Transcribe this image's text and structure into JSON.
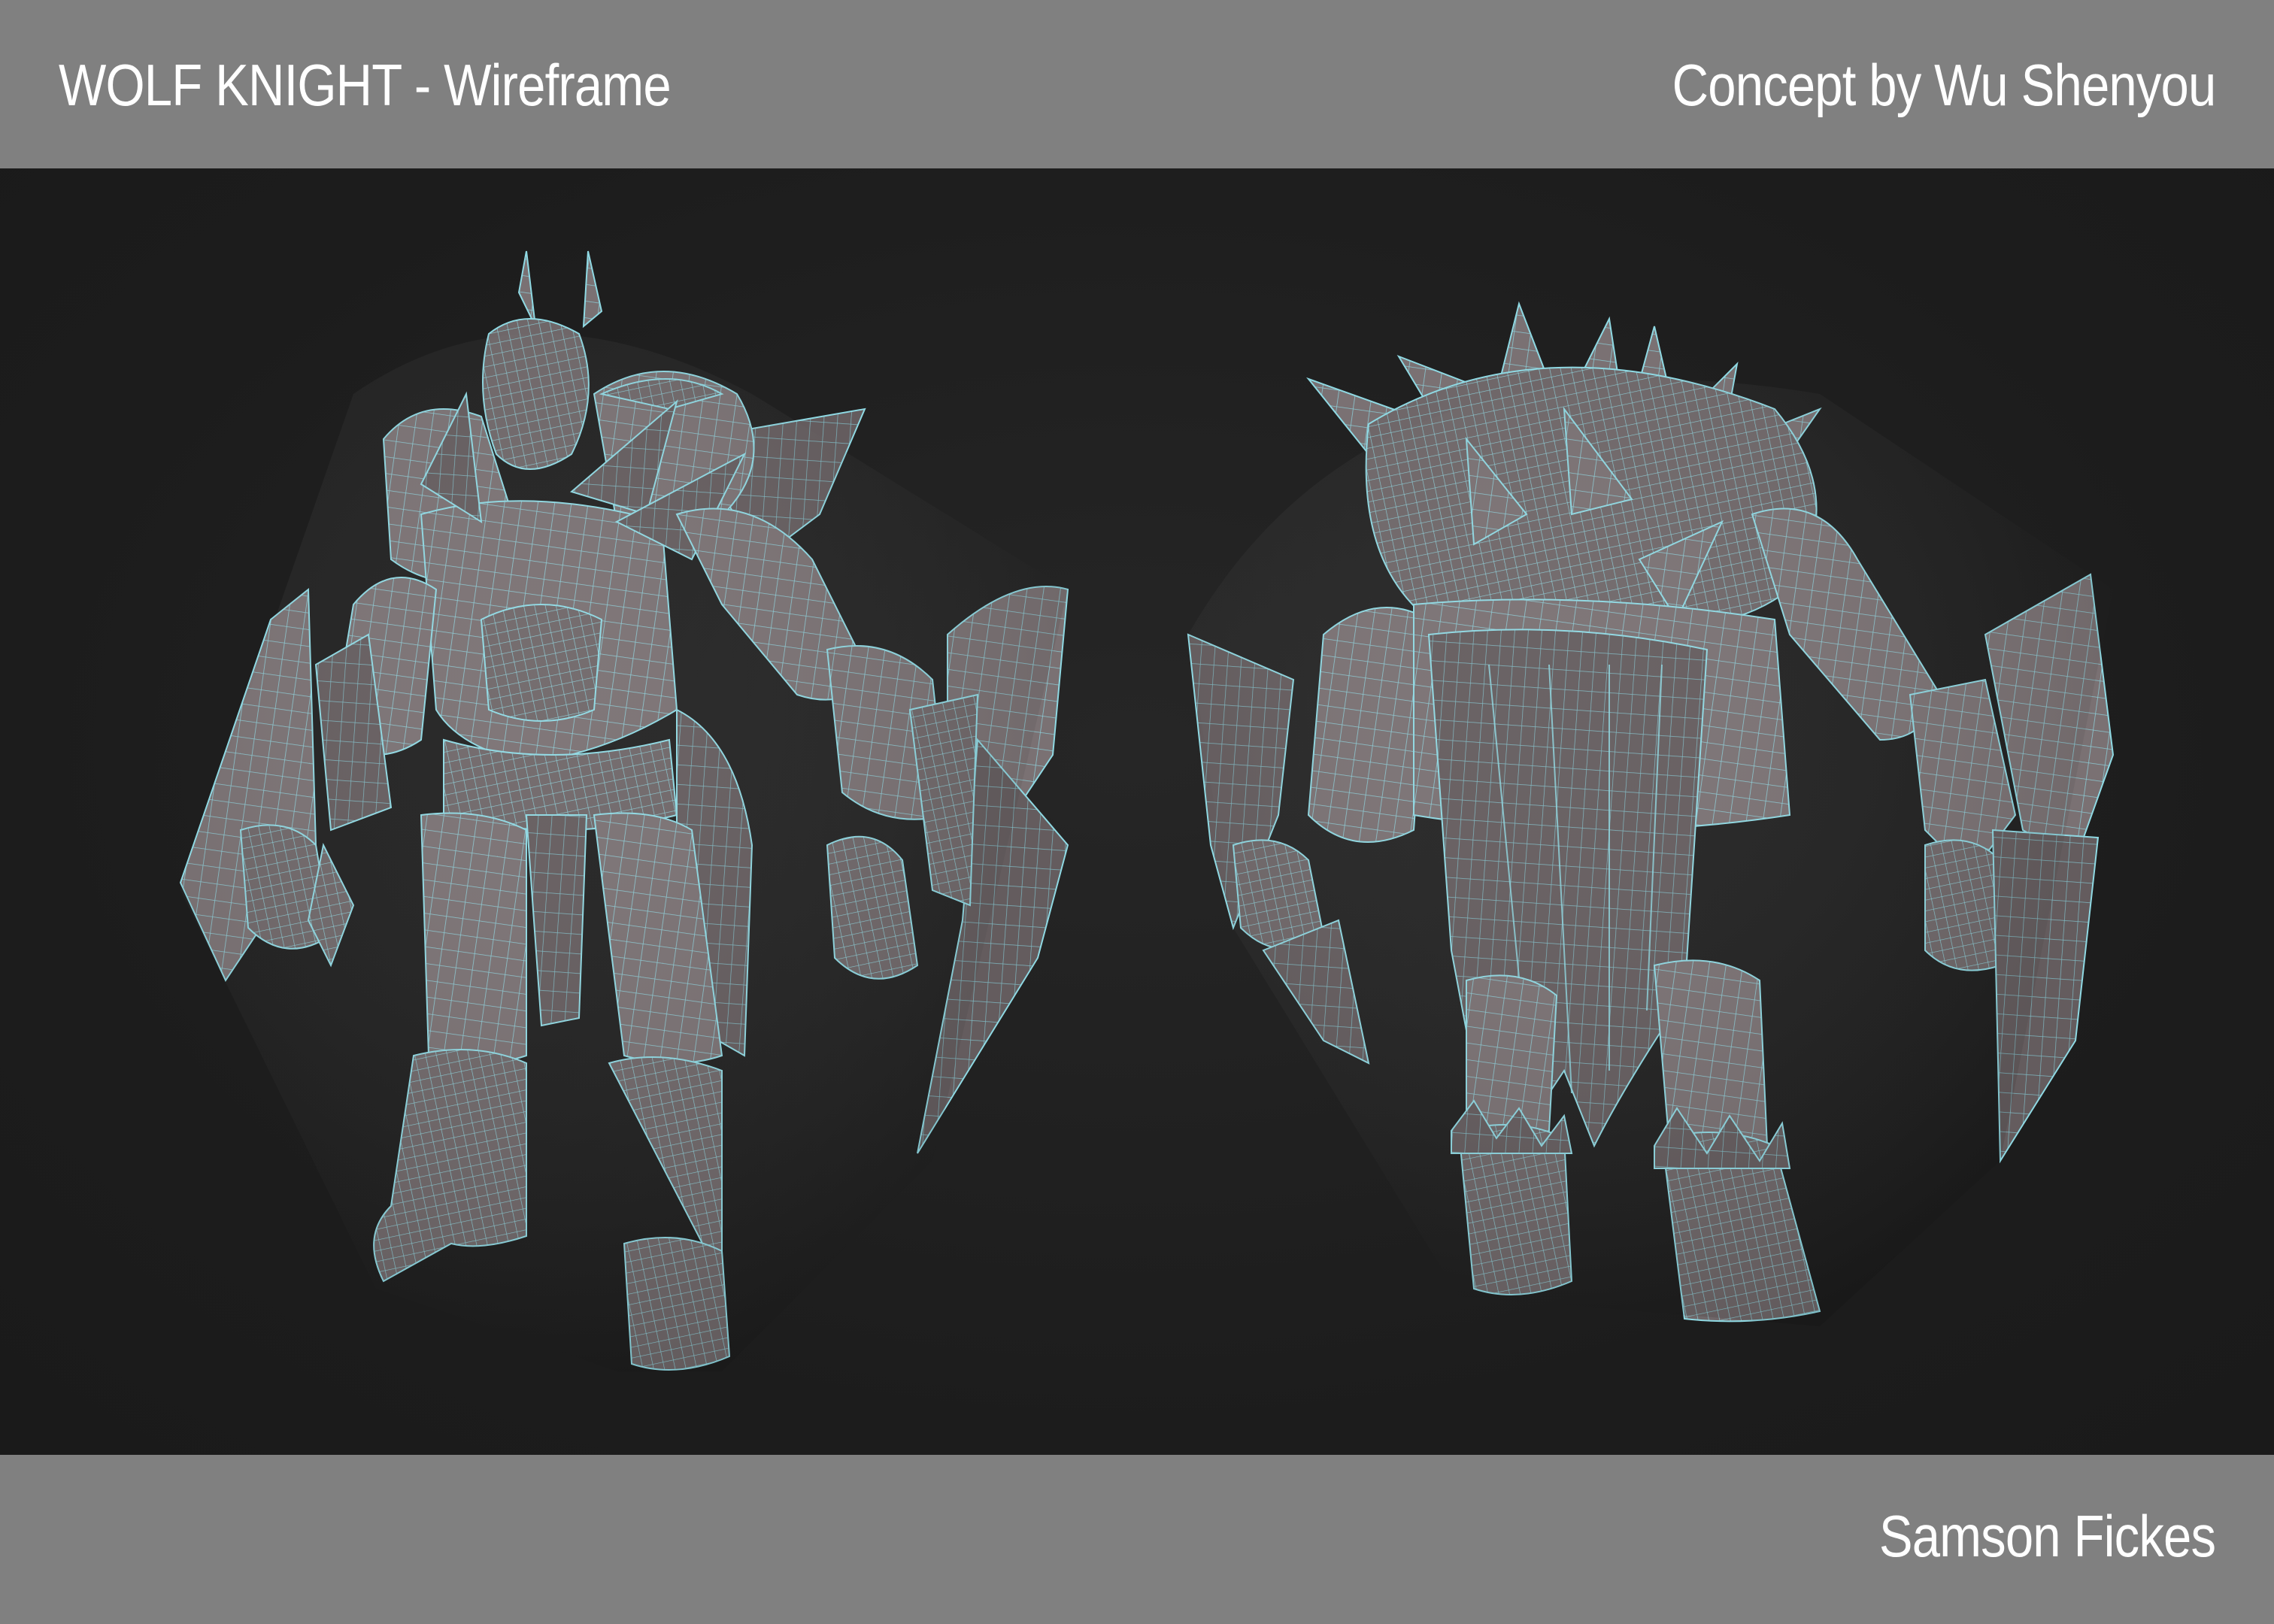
{
  "header": {
    "title": "WOLF KNIGHT - Wireframe",
    "concept_credit": "Concept by Wu Shenyou"
  },
  "footer": {
    "artist": "Samson Fickes"
  },
  "colors": {
    "bar": "#808080",
    "viewport": "#1d1d1d",
    "mesh_fill": "#7d7476",
    "wire": "#7fd6e0",
    "text": "#ffffff"
  }
}
